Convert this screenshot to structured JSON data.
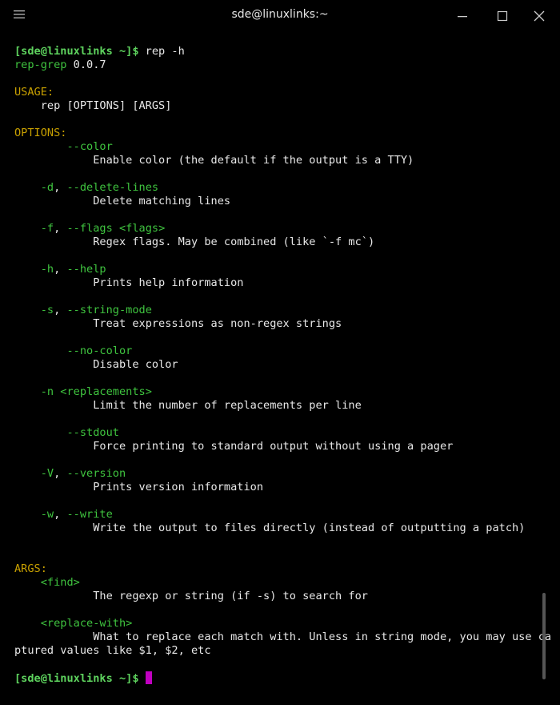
{
  "window": {
    "title": "sde@linuxlinks:~"
  },
  "icons": {
    "menu": "hamburger-menu-icon",
    "minimize": "minimize-icon",
    "maximize": "maximize-icon",
    "close": "close-icon"
  },
  "terminal": {
    "prompt": "[sde@linuxlinks ~]$",
    "command": " rep -h",
    "app_name": "rep-grep",
    "version": " 0.0.7",
    "usage_header": "USAGE:",
    "usage_line": "    rep [OPTIONS] [ARGS]",
    "options_header": "OPTIONS:",
    "options": [
      {
        "indent": "        ",
        "flag": "--color",
        "desc": "Enable color (the default if the output is a TTY)"
      },
      {
        "indent": "    ",
        "flag_short": "-d",
        "flag": "--delete-lines",
        "desc": "Delete matching lines"
      },
      {
        "indent": "    ",
        "flag_short": "-f",
        "flag": "--flags <flags>",
        "desc": "Regex flags. May be combined (like `-f mc`)"
      },
      {
        "indent": "    ",
        "flag_short": "-h",
        "flag": "--help",
        "desc": "Prints help information"
      },
      {
        "indent": "    ",
        "flag_short": "-s",
        "flag": "--string-mode",
        "desc": "Treat expressions as non-regex strings"
      },
      {
        "indent": "        ",
        "flag": "--no-color",
        "desc": "Disable color"
      },
      {
        "indent": "    ",
        "flag": "-n <replacements>",
        "desc": "Limit the number of replacements per line"
      },
      {
        "indent": "        ",
        "flag": "--stdout",
        "desc": "Force printing to standard output without using a pager"
      },
      {
        "indent": "    ",
        "flag_short": "-V",
        "flag": "--version",
        "desc": "Prints version information"
      },
      {
        "indent": "    ",
        "flag_short": "-w",
        "flag": "--write",
        "desc": "Write the output to files directly (instead of outputting a patch)"
      }
    ],
    "args_header": "ARGS:",
    "args": [
      {
        "name": "<find>",
        "desc": "The regexp or string (if -s) to search for"
      },
      {
        "name": "<replace-with>",
        "desc": "What to replace each match with. Unless in string mode, you may use ca",
        "desc_cont": "ptured values like $1, $2, etc"
      }
    ],
    "desc_indent": "            ",
    "arg_indent": "    ",
    "sep": ", "
  },
  "colors": {
    "background": "#000000",
    "green": "#3fc43f",
    "yellow": "#c8a000",
    "cursor": "#c000c0"
  }
}
